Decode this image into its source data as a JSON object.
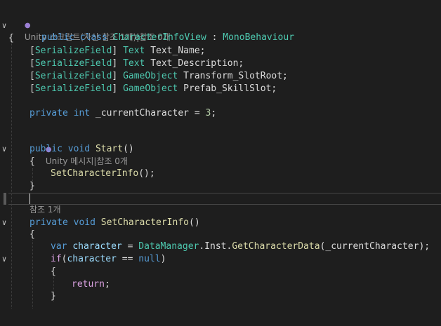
{
  "lens": {
    "class_refs": "Unity 스크립트(자산 참조 1개)|참조 0개",
    "start_refs": "Unity 메시지|참조 0개",
    "setinfo_refs": "참조 1개"
  },
  "code": {
    "class_decl": {
      "kw1": "public",
      "kw2": "class",
      "name": "CharacterInfoView",
      "colon": " : ",
      "base": "MonoBehaviour"
    },
    "open_brace": "{",
    "fields": [
      {
        "attr": "SerializeField",
        "type": "Text",
        "name": " Text_Name;"
      },
      {
        "attr": "SerializeField",
        "type": "Text",
        "name": " Text_Description;"
      },
      {
        "attr": "SerializeField",
        "type": "GameObject",
        "name": " Transform_SlotRoot;"
      },
      {
        "attr": "SerializeField",
        "type": "GameObject",
        "name": " Prefab_SkillSlot;"
      }
    ],
    "private_field": {
      "kw1": "private",
      "kw2": "int",
      "name": " _currentCharacter = ",
      "value": "3",
      "end": ";"
    },
    "start": {
      "kw1": "public",
      "kw2": "void",
      "name": "Start",
      "parens": "()"
    },
    "start_open": "{",
    "start_call": {
      "name": "SetCharacterInfo",
      "rest": "();"
    },
    "start_close": "}",
    "setinfo": {
      "kw1": "private",
      "kw2": "void",
      "name": "SetCharacterInfo",
      "parens": "()"
    },
    "setinfo_open": "{",
    "var_line": {
      "kw": "var",
      "local": "character",
      "eq": " = ",
      "cls": "DataManager",
      "dot1": ".",
      "prop": "Inst",
      "dot2": ".",
      "method": "GetCharacterData",
      "open": "(",
      "arg": "_currentCharacter",
      "close": ");"
    },
    "if_line": {
      "kw": "if",
      "open": "(",
      "local": "character",
      "op": " == ",
      "nullkw": "null",
      "close": ")"
    },
    "if_open": "{",
    "return_line": {
      "kw": "return",
      "end": ";"
    },
    "if_close": "}"
  },
  "colors": {
    "background": "#1e1e1e",
    "keyword": "#569cd6",
    "type": "#4ec9b0",
    "method": "#dcdcaa",
    "control": "#d8a0df",
    "number": "#b5cea8",
    "local": "#9cdcfe"
  },
  "icons": [
    "fold-collapse-icon",
    "unity-icon"
  ]
}
